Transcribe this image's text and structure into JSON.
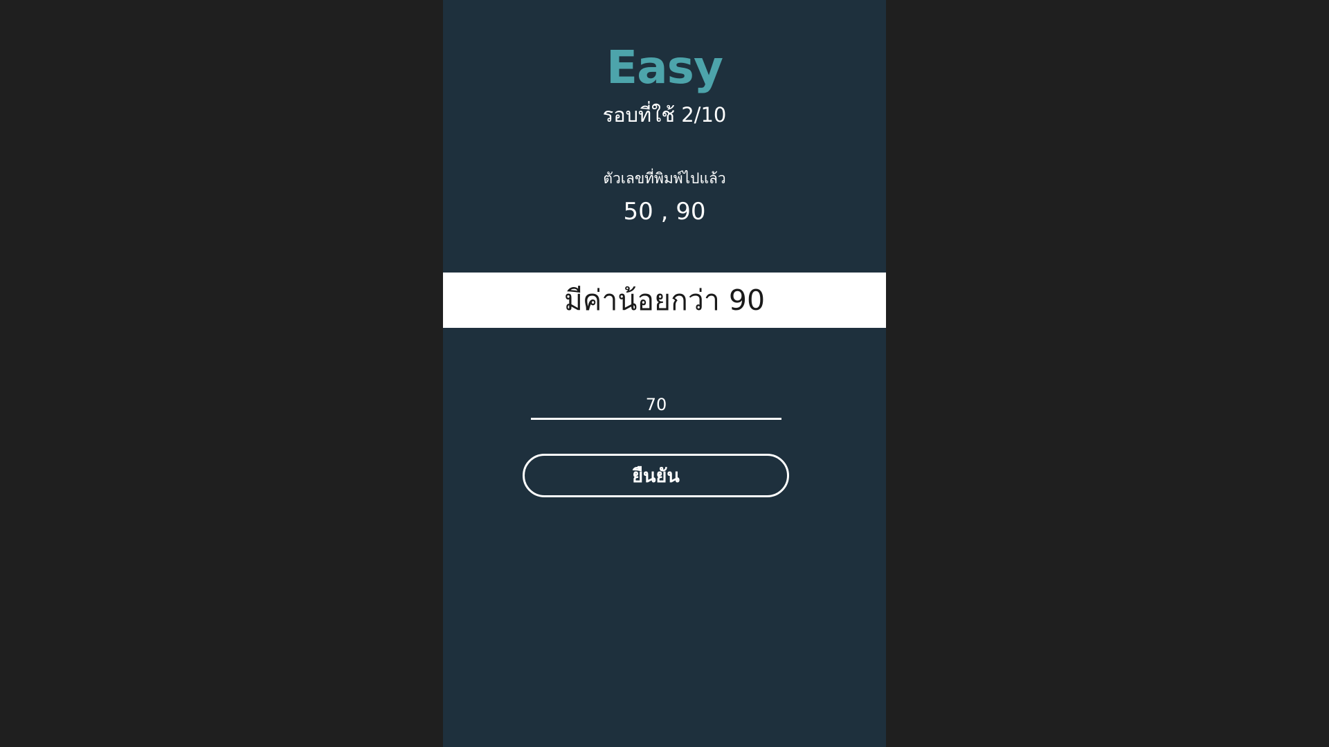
{
  "game": {
    "difficulty": "Easy",
    "round_text": "รอบที่ใช้ 2/10",
    "typed_label": "ตัวเลขที่พิมพ์ไปแล้ว",
    "typed_values": "50 , 90",
    "hint": "มีค่าน้อยกว่า 90",
    "guess_value": "70",
    "confirm_label": "ยืนยัน"
  },
  "colors": {
    "page_background": "#1f1f1f",
    "panel_background": "#1e303d",
    "accent": "#4da4ab",
    "hint_bar": "#ffffff",
    "text": "#ffffff"
  }
}
